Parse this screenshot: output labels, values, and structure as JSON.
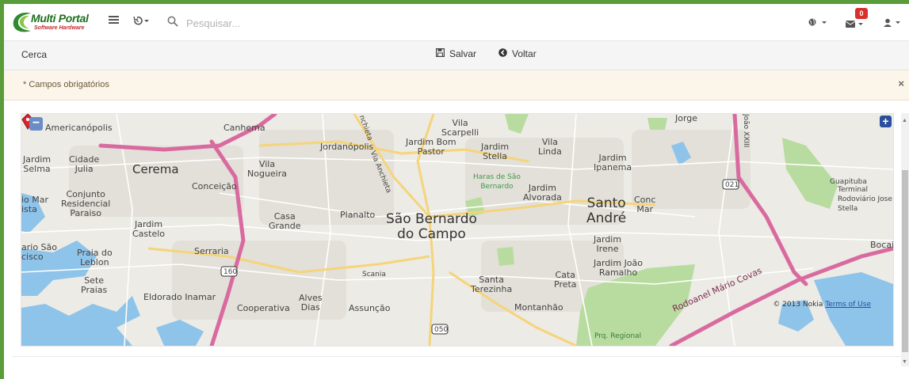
{
  "app": {
    "logo_line1": "Multi Portal",
    "logo_line2": "Software Hardware",
    "brand_green": "#5a9b3a",
    "brand_red": "#c6262e"
  },
  "topbar": {
    "search_placeholder": "Pesquisar...",
    "menu_icon": "hamburger-icon",
    "history_icon": "history-icon",
    "globe_icon": "globe-icon",
    "mail_icon": "envelope-icon",
    "mail_badge": "0",
    "user_icon": "user-icon"
  },
  "actionbar": {
    "title": "Cerca",
    "save_label": "Salvar",
    "back_label": "Voltar"
  },
  "alert": {
    "text": "* Campos obrigatórios",
    "close": "×"
  },
  "map": {
    "zoom_out": "−",
    "zoom_in": "+",
    "copyright": "© 2013 Nokia",
    "terms": "Terms of Use",
    "labels": {
      "americanopolis": "Americanópolis",
      "canhema": "Canhema",
      "vila_scarpelli": "Vila\nScarpelli",
      "jordanopolis": "Jordanópolis",
      "jardim_bom_pastor": "Jardim Bom\nPastor",
      "jardim_stella": "Jardim\nStella",
      "vila_linda": "Vila\nLinda",
      "jorge": "Jorge",
      "jardim_selma": "Jardim\nSelma",
      "cidade_julia": "Cidade\nJulia",
      "cerema": "Cerema",
      "vila_nogueira": "Vila\nNogueira",
      "haras": "Haras de São\nBernardo",
      "jardim_ipanema": "Jardim\nIpanema",
      "conceicao": "Conceição",
      "jardim_alvorada": "Jardim\nAlvorada",
      "conjunto": "Conjunto\nResidencial\nParaiso",
      "rio_mar": "io Mar\nista",
      "casa_grande": "Casa\nGrande",
      "planalto": "Planalto",
      "sao_bernardo": "São Bernardo\ndo Campo",
      "santo_andre": "Santo\nAndré",
      "conc_mar": "Conc\nMar",
      "guapituba": "Guapituba",
      "terminal": "Terminal\nRodoviário Jose\nStella",
      "jardim_castelo": "Jardim\nCastelo",
      "rio_sao": "ario São\ncisco",
      "praia_leblon": "Praia do\nLeblon",
      "serraria": "Serraria",
      "jardim_irene": "Jardim\nIrene",
      "bocai": "Bocai",
      "jardim_joao_ramalho": "Jardim João\nRamalho",
      "scania": "Scania",
      "sete_praias": "Sete\nPraias",
      "santa_terezinha": "Santa\nTerezinha",
      "cata_preta": "Cata\nPreta",
      "eldorado": "Eldorado Inamar",
      "alves_dias": "Alves\nDias",
      "cooperativa": "Cooperativa",
      "assuncao": "Assunção",
      "montanhao": "Montanhão",
      "rodoanel": "Rodoanel Mário Covas",
      "prq_regional": "Prq. Regional",
      "via_anchieta": "Via Anchieta",
      "anchieta": "nchieta",
      "joao_xxiii": "João XXIII",
      "shield_160": "160",
      "shield_021": "021",
      "shield_050": "050"
    },
    "colors": {
      "land": "#f0efea",
      "water": "#8ec3ea",
      "park": "#b8dca0",
      "highway": "#d96aa0",
      "main_road": "#f5d47a"
    }
  }
}
